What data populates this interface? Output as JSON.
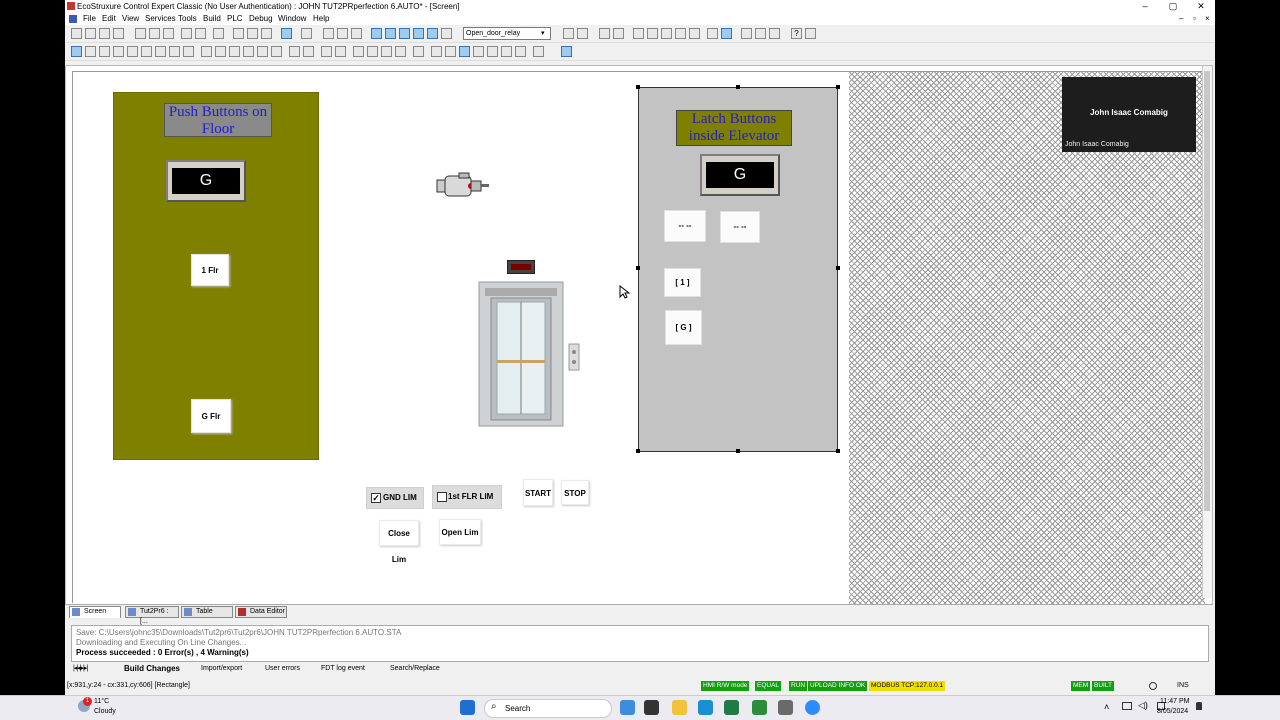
{
  "window": {
    "title": "EcoStruxure Control Expert Classic (No User Authentication) : JOHN TUT2PRperfection 6.AUTO* - [Screen]",
    "controls": [
      "–",
      "▢",
      "✕"
    ],
    "inner_controls": [
      "–",
      "▫",
      "×"
    ]
  },
  "menu": [
    "File",
    "Edit",
    "View",
    "Services",
    "Tools",
    "Build",
    "PLC",
    "Debug",
    "Window",
    "Help"
  ],
  "toolbar": {
    "variable_select": "Open_door_relay"
  },
  "screen": {
    "floor_panel": {
      "title_line1": "Push Buttons on",
      "title_line2": "Floor",
      "display": "G",
      "btn_1": "1 Flr",
      "btn_g": "G Flr"
    },
    "latch_panel": {
      "title_line1": "Latch Buttons",
      "title_line2": "inside Elevator",
      "display": "G",
      "btn_a": "-- --",
      "btn_b": "-- --",
      "btn_1": "[ 1 ]",
      "btn_g": "[ G ]"
    },
    "controls": {
      "gnd_lim": "GND LIM",
      "first_flr_lim": "1st FLR LIM",
      "start": "START",
      "stop": "STOP",
      "close_lim": "Close Lim",
      "open_lim": "Open Lim",
      "gnd_lim_checked": true,
      "first_flr_lim_checked": false
    }
  },
  "video": {
    "name": "John Isaac Comabig",
    "caption": "John Isaac Comabig"
  },
  "doc_tabs": [
    "Screen",
    "Tut2Pr6 : [...",
    "Table",
    "Data Editor"
  ],
  "output": {
    "line1": "Save: C:\\Users\\johnc35\\Downloads\\Tut2pr6\\Tut2pr6\\JOHN TUT2PRperfection 6.AUTO.STA",
    "line2": "Downloading and Executing On Line Changes...",
    "line3": "Process succeeded : 0 Error(s) , 4 Warning(s)"
  },
  "output_tabs": [
    "Build Changes",
    "Import/export",
    "User errors",
    "FDT log event",
    "Search/Replace"
  ],
  "status": {
    "coords": "[x:931,y:24 - cx:331,cy:606] [Rectangle]",
    "hmi": "HMI R/W mode",
    "equal": "EQUAL",
    "run": "RUN",
    "upload": "UPLOAD INFO OK",
    "modbus": "MODBUS TCP:127.0.0.1",
    "mem": "MEM",
    "built": "BUILT",
    "ins": "INS"
  },
  "taskbar": {
    "temp": "11°C",
    "weather": "Cloudy",
    "badge": "1",
    "search": "Search",
    "time": "11:47 PM",
    "date": "8/05/2024"
  },
  "colors": {
    "olive": "#808000",
    "grey_panel": "#c3c3c3",
    "status_green": "#12a012",
    "modbus_yellow": "#f0e000"
  }
}
